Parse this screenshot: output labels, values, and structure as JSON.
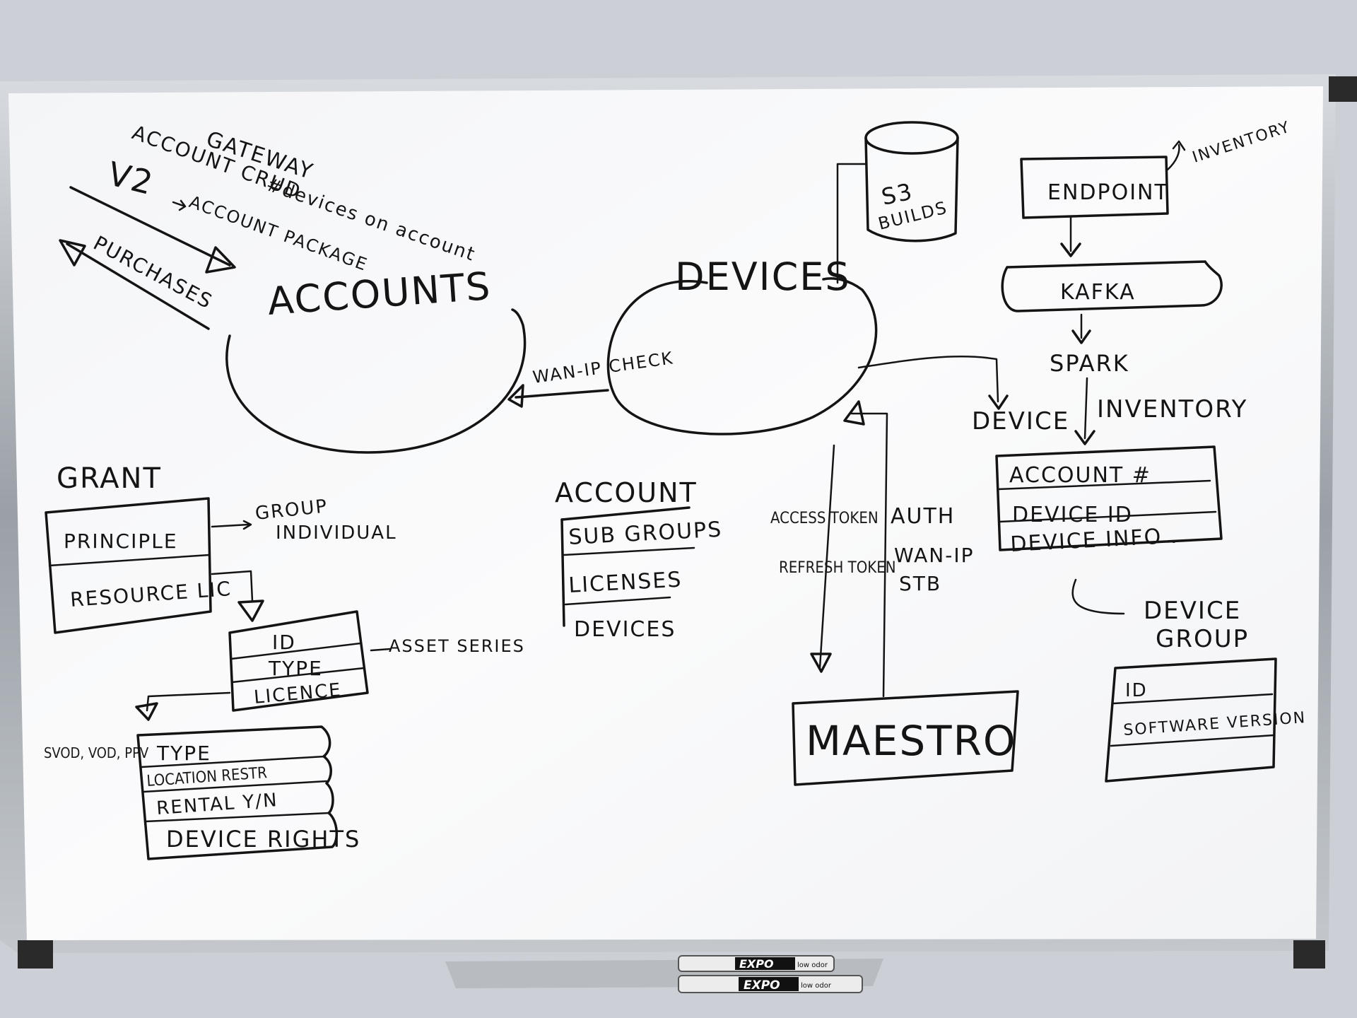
{
  "board": {
    "accounts_notes": {
      "gateway": "GATEWAY",
      "account_crud": "ACCOUNT CRUD",
      "v2": "V2",
      "account_package": "ACCOUNT PACKAGE",
      "devices_on_account": "#devices on account",
      "purchases": "PURCHASES",
      "accounts": "ACCOUNTS"
    },
    "devices": {
      "title": "DEVICES",
      "wan_ip_check": "WAN-IP CHECK"
    },
    "s3": {
      "line1": "S3",
      "line2": "BUILDS"
    },
    "pipeline": {
      "endpoint": "ENDPOINT",
      "inventory": "INVENTORY",
      "kafka": "KAFKA",
      "spark": "SPARK",
      "device": "DEVICE",
      "inventory_label": "INVENTORY"
    },
    "device_inventory_table": [
      "ACCOUNT #",
      "DEVICE ID",
      "DEVICE INFO ."
    ],
    "device_group": {
      "title1": "DEVICE",
      "title2": "GROUP",
      "rows": [
        "ID",
        "SOFTWARE VERSION",
        ""
      ]
    },
    "grant": {
      "title": "GRANT",
      "rows": [
        "PRINCIPLE",
        "RESOURCE LIC"
      ],
      "group": "GROUP",
      "individual": "INDIVIDUAL"
    },
    "resource_table": {
      "rows": [
        "ID",
        "TYPE",
        "LICENCE"
      ],
      "asset_series": "ASSET SERIES"
    },
    "license_table": {
      "side": "SVOD, VOD, PPV",
      "rows": [
        "TYPE",
        "LOCATION RESTR",
        "RENTAL Y/N",
        "DEVICE RIGHTS"
      ]
    },
    "account_table": {
      "title": "ACCOUNT",
      "rows": [
        "SUB GROUPS",
        "LICENSES",
        "DEVICES"
      ]
    },
    "maestro": {
      "title": "MAESTRO",
      "access_token": "ACCESS TOKEN",
      "refresh_token": "REFRESH TOKEN",
      "auth": "AUTH",
      "wan_ip": "WAN-IP",
      "stb": "STB"
    },
    "markers": {
      "brand": "EXPO",
      "tag": "low odor"
    }
  },
  "colors": {
    "wall": "#cdd1d7",
    "board": "#f7f8f9",
    "frame": "#9aa0a6",
    "ink": "#141414"
  }
}
